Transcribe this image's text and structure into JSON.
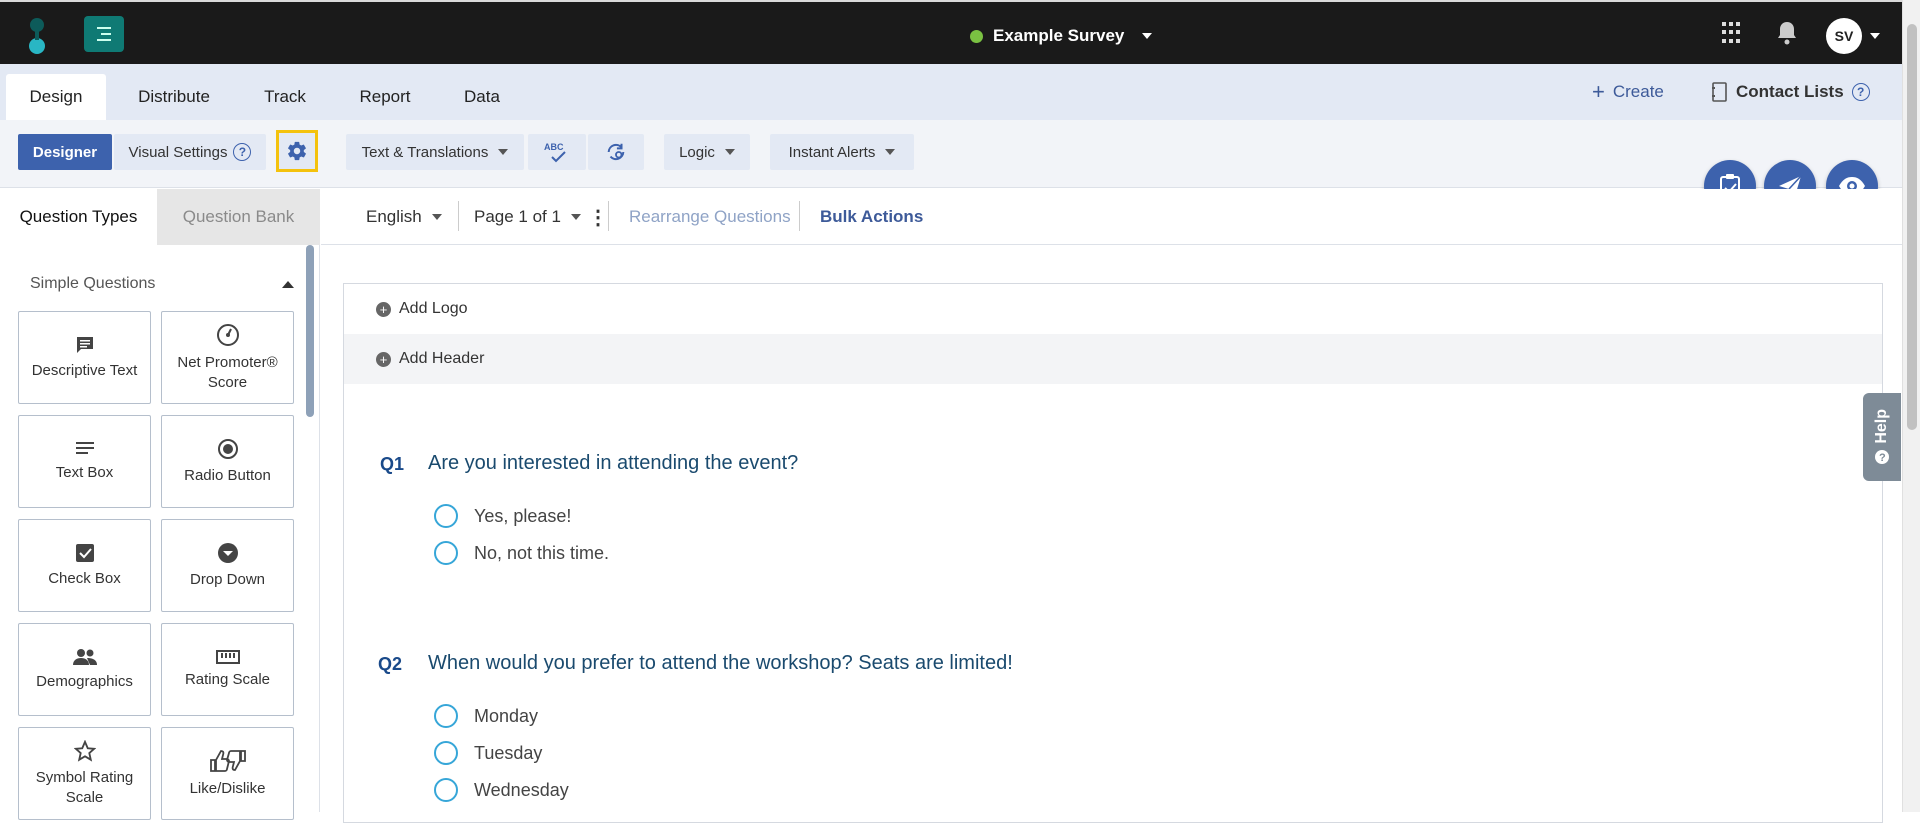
{
  "topbar": {
    "survey_title": "Example Survey",
    "avatar": "SV"
  },
  "tabs": [
    "Design",
    "Distribute",
    "Track",
    "Report",
    "Data"
  ],
  "tab_right": {
    "create": "Create",
    "contact_lists": "Contact Lists"
  },
  "toolbar": {
    "designer": "Designer",
    "visual_settings": "Visual Settings",
    "text_translations": "Text & Translations",
    "abc": "ABC",
    "logic": "Logic",
    "instant_alerts": "Instant Alerts"
  },
  "left_panel": {
    "tab_active": "Question Types",
    "tab_inactive": "Question Bank",
    "section": "Simple Questions",
    "cards": [
      {
        "label": "Descriptive Text",
        "icon": "comment-icon"
      },
      {
        "label": "Net Promoter® Score",
        "icon": "gauge-icon"
      },
      {
        "label": "Text Box",
        "icon": "lines-icon"
      },
      {
        "label": "Radio Button",
        "icon": "radio-icon"
      },
      {
        "label": "Check Box",
        "icon": "checkbox-icon"
      },
      {
        "label": "Drop Down",
        "icon": "dropdown-icon"
      },
      {
        "label": "Demographics",
        "icon": "people-icon"
      },
      {
        "label": "Rating Scale",
        "icon": "ruler-icon"
      },
      {
        "label": "Symbol Rating Scale",
        "icon": "star-icon"
      },
      {
        "label": "Like/Dislike",
        "icon": "thumbs-icon"
      }
    ]
  },
  "subbar": {
    "language": "English",
    "page": "Page 1 of 1",
    "rearrange": "Rearrange Questions",
    "bulk": "Bulk Actions"
  },
  "canvas": {
    "add_logo": "Add Logo",
    "add_header": "Add Header",
    "questions": [
      {
        "num": "Q1",
        "text": "Are you interested in attending the event?",
        "options": [
          "Yes, please!",
          "No, not this time."
        ]
      },
      {
        "num": "Q2",
        "text": "When would you prefer to attend the workshop? Seats are limited!",
        "options": [
          "Monday",
          "Tuesday",
          "Wednesday"
        ]
      }
    ]
  },
  "help": "Help",
  "colors": {
    "accent": "#3d62ad",
    "highlight": "#f4c20d",
    "radio": "#36a6d8"
  }
}
